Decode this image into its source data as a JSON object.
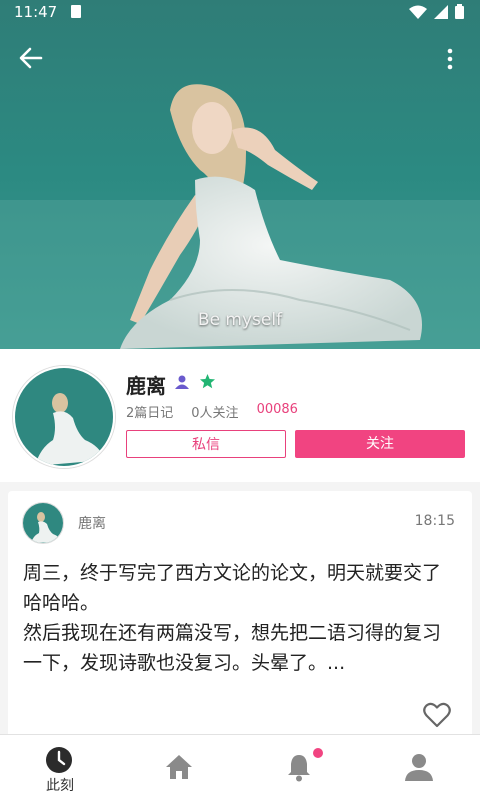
{
  "status_bar": {
    "time": "11:47"
  },
  "cover": {
    "caption": "Be myself"
  },
  "profile": {
    "name": "鹿离",
    "diary_count": "2篇日记",
    "follow_count": "0人关注",
    "user_id": "00086",
    "message_label": "私信",
    "follow_label": "关注"
  },
  "post": {
    "author": "鹿离",
    "time": "18:15",
    "line1": "周三，终于写完了西方文论的论文，明天就要交了哈哈哈。",
    "line2": "然后我现在还有两篇没写，想先把二语习得的复习一下，发现诗歌也没复习。头晕了。..."
  },
  "bottom_nav": [
    {
      "label": "此刻",
      "icon": "clock-icon"
    },
    {
      "label": "",
      "icon": "home-icon"
    },
    {
      "label": "",
      "icon": "bell-icon"
    },
    {
      "label": "",
      "icon": "person-icon"
    }
  ],
  "colors": {
    "accent": "#f14481",
    "muted": "#777777",
    "cover_water": "#2c7f78"
  }
}
